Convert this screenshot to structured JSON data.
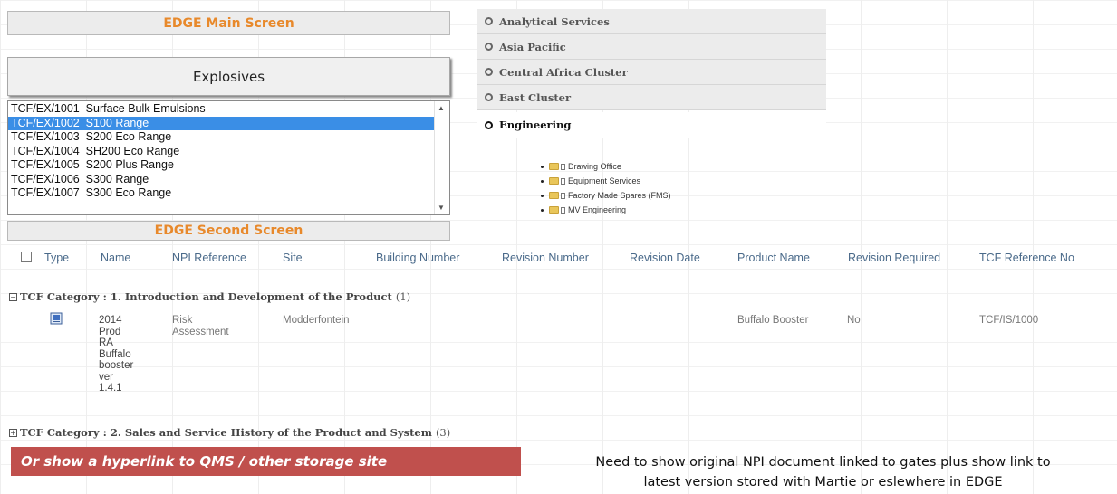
{
  "main_screen": {
    "title": "EDGE Main Screen",
    "category_button": "Explosives",
    "list_items": [
      "TCF/EX/1001  Surface Bulk Emulsions",
      "TCF/EX/1002  S100 Range",
      "TCF/EX/1003  S200 Eco Range",
      "TCF/EX/1004  SH200 Eco Range",
      "TCF/EX/1005  S200 Plus Range",
      "TCF/EX/1006  S300 Range",
      "TCF/EX/1007  S300 Eco Range"
    ],
    "selected_index": 1
  },
  "second_screen": {
    "title": "EDGE Second Screen"
  },
  "accordion": {
    "items": [
      "Analytical Services",
      "Asia Pacific",
      "Central Africa Cluster",
      "East Cluster",
      "Engineering"
    ],
    "active_index": 4,
    "engineering_children": [
      "Drawing Office",
      "Equipment Services",
      "Factory Made Spares (FMS)",
      "MV Engineering"
    ]
  },
  "table": {
    "columns": [
      "Type",
      "Name",
      "NPI Reference",
      "Site",
      "Building Number",
      "Revision Number",
      "Revision Date",
      "Product Name",
      "Revision Required",
      "TCF Reference No"
    ],
    "categories": [
      {
        "label": "TCF Category : 1. Introduction and Development of the Product",
        "count": "(1)",
        "expanded": true
      },
      {
        "label": "TCF Category : 2. Sales and Service History of the Product and System",
        "count": "(3)",
        "expanded": false
      }
    ],
    "row": {
      "name_lines": [
        "2014",
        "Prod",
        "RA",
        "Buffalo",
        "booster",
        "ver",
        "1.4.1"
      ],
      "npi_lines": [
        "Risk",
        "Assessment"
      ],
      "site": "Modderfontein",
      "product_name": "Buffalo Booster",
      "revision_required": "No",
      "tcf_reference": "TCF/IS/1000"
    }
  },
  "annotations": {
    "red_note": "Or show a hyperlink to QMS / other storage site",
    "right_note_line1": "Need to show original NPI document linked to gates plus show link to",
    "right_note_line2": "latest version stored with Martie or eslewhere in EDGE"
  },
  "colors": {
    "accent_orange": "#e8892b",
    "selection_blue": "#3a8ee6",
    "note_red": "#c0504d"
  }
}
